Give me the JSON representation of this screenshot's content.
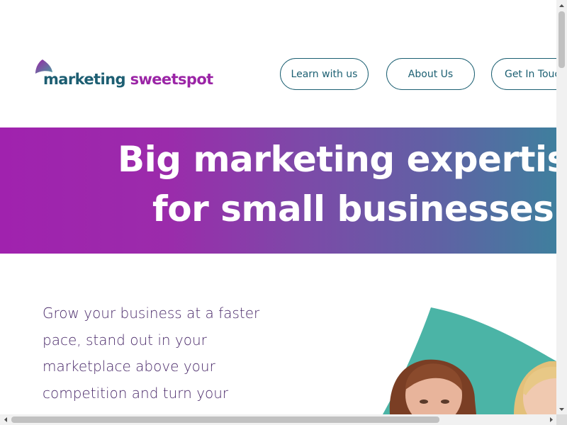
{
  "header": {
    "logo": {
      "word1": "marketing",
      "word2": "sweetspot"
    },
    "nav": [
      {
        "label": "Learn with us"
      },
      {
        "label": "About Us"
      },
      {
        "label": "Get In Touch"
      }
    ]
  },
  "hero": {
    "line1": "Big marketing expertise",
    "line2": "for small businesses",
    "gradient_colors": [
      "#a022ae",
      "#3f7f9e"
    ]
  },
  "main": {
    "intro": "Grow your business at a faster pace, stand out in your marketplace above your competition and turn your"
  },
  "colors": {
    "brand_teal": "#1b5f72",
    "brand_purple": "#9b25a6",
    "accent_teal": "#4bb4a6"
  },
  "icons": {
    "logo_mark": "leaf-logo-icon",
    "scroll_up": "arrow-up-icon",
    "scroll_down": "arrow-down-icon",
    "scroll_left": "arrow-left-icon",
    "scroll_right": "arrow-right-icon"
  }
}
